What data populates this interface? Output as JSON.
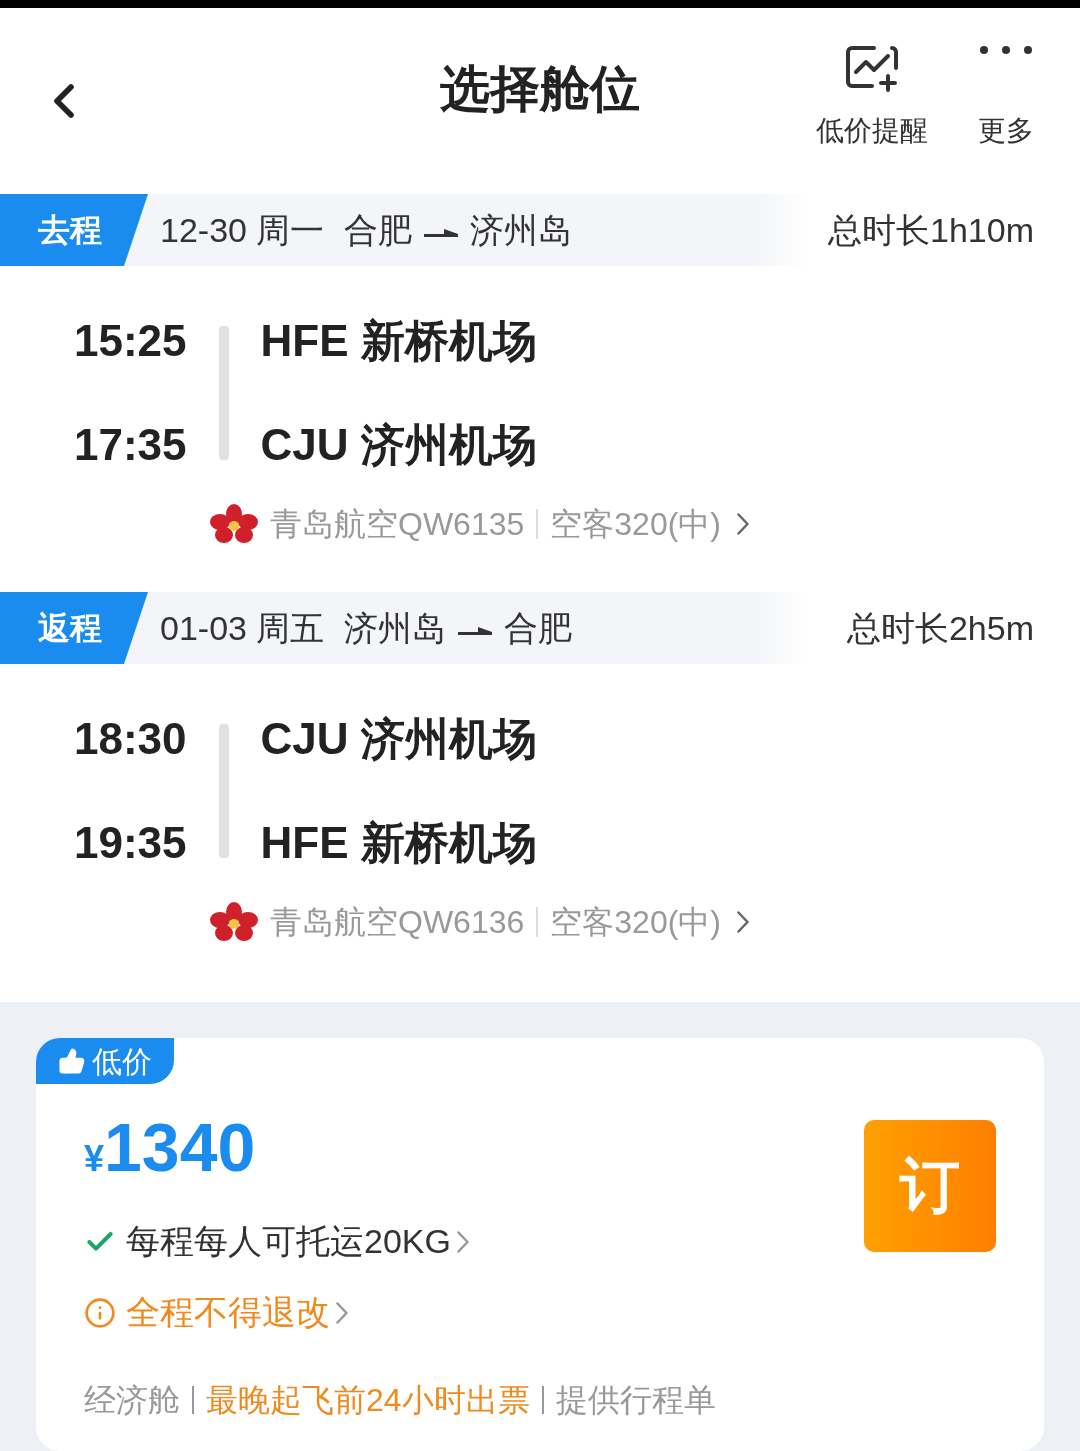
{
  "header": {
    "title": "选择舱位",
    "actions": [
      {
        "kind": "alert",
        "label": "低价提醒"
      },
      {
        "kind": "more",
        "label": "更多"
      }
    ]
  },
  "legs": [
    {
      "tag": "去程",
      "date": "12-30 周一",
      "from": "合肥",
      "to": "济州岛",
      "duration": "总时长1h10m",
      "stops": [
        {
          "time": "15:25",
          "airport": "HFE 新桥机场"
        },
        {
          "time": "17:35",
          "airport": "CJU 济州机场"
        }
      ],
      "airline": "青岛航空QW6135",
      "aircraft": "空客320(中)"
    },
    {
      "tag": "返程",
      "date": "01-03 周五",
      "from": "济州岛",
      "to": "合肥",
      "duration": "总时长2h5m",
      "stops": [
        {
          "time": "18:30",
          "airport": "CJU 济州机场"
        },
        {
          "time": "19:35",
          "airport": "HFE 新桥机场"
        }
      ],
      "airline": "青岛航空QW6136",
      "aircraft": "空客320(中)"
    }
  ],
  "fare": {
    "badge": "低价",
    "currency": "¥",
    "price": "1340",
    "book": "订",
    "notes": [
      {
        "kind": "check",
        "text": "每程每人可托运20KG"
      },
      {
        "kind": "warning",
        "text": "全程不得退改"
      }
    ],
    "tags": [
      {
        "text": "经济舱",
        "highlight": false
      },
      {
        "text": "最晚起飞前24小时出票",
        "highlight": true
      },
      {
        "text": "提供行程单",
        "highlight": false
      }
    ]
  }
}
